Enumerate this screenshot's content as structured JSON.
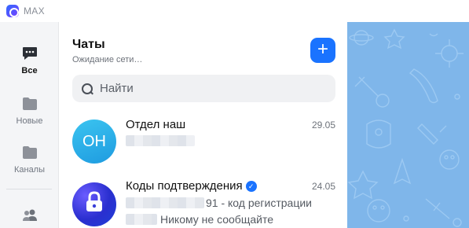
{
  "app": {
    "title": "MAX"
  },
  "rail": {
    "items": [
      {
        "label": "Все",
        "icon": "chat-bubble-icon",
        "active": true
      },
      {
        "label": "Новые",
        "icon": "folder-icon",
        "active": false
      },
      {
        "label": "Каналы",
        "icon": "folder-icon",
        "active": false
      },
      {
        "label": "",
        "icon": "contacts-icon",
        "active": false
      }
    ]
  },
  "header": {
    "title": "Чаты",
    "status": "Ожидание сети…",
    "new_button": "+"
  },
  "search": {
    "placeholder": "Найти"
  },
  "chats": [
    {
      "name": "Отдел наш",
      "date": "29.05",
      "avatar_text": "ОН",
      "preview": ""
    },
    {
      "name": "Коды подтверждения",
      "date": "24.05",
      "avatar_icon": "lock-icon",
      "verified": true,
      "preview_line1": "91 - код регистрации",
      "preview_line2": "Никому не сообщайте"
    }
  ],
  "colors": {
    "accent": "#1a73ff",
    "wallpaper": "#7fb6ea",
    "rail_bg": "#f4f5f7"
  }
}
